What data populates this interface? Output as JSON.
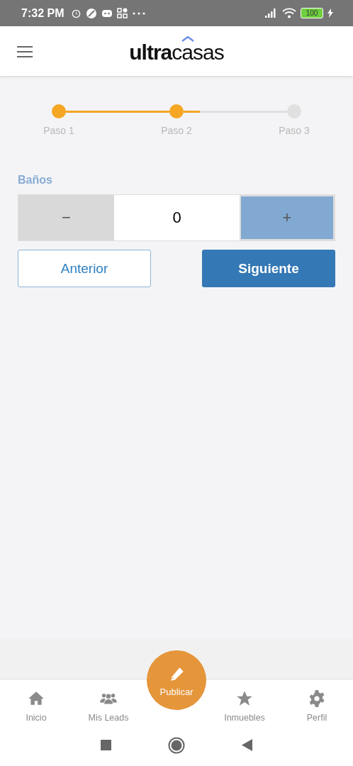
{
  "status_bar": {
    "time": "7:32 PM",
    "battery": "100"
  },
  "header": {
    "logo": "**ultra**casas"
  },
  "steps": {
    "items": [
      {
        "label": "Paso 1",
        "done": true,
        "level": 1
      },
      {
        "label": "Paso 2",
        "done": true,
        "level": 0.16
      },
      {
        "label": "Paso 3",
        "done": false
      }
    ]
  },
  "field": {
    "label": "Baños",
    "minus": "−",
    "value": "0",
    "plus": "+"
  },
  "buttons": [
    {
      "label": "Anterior",
      "kind": "outline"
    },
    {
      "label": "Siguiente",
      "kind": "primary"
    }
  ],
  "bottom_nav": {
    "items": [
      {
        "label": "Inicio"
      },
      {
        "label": "Mis Leads"
      },
      {
        "label": "Publicar",
        "kind": "fab"
      },
      {
        "label": "Inmuebles"
      },
      {
        "label": "Perfil"
      }
    ]
  }
}
